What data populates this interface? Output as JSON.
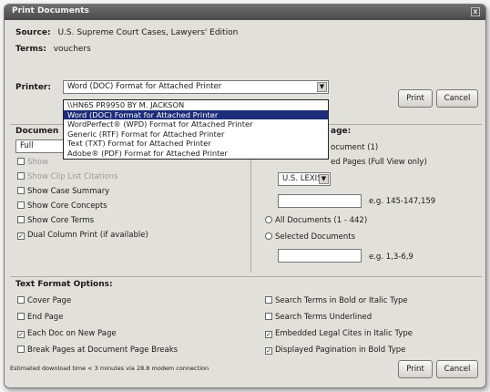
{
  "window": {
    "title": "Print Documents",
    "close_glyph": "x"
  },
  "source": {
    "label": "Source:",
    "value": "U.S. Supreme Court Cases, Lawyers' Edition"
  },
  "terms": {
    "label": "Terms:",
    "value": "vouchers"
  },
  "printer": {
    "label": "Printer:",
    "selected": "Word (DOC) Format for Attached Printer",
    "options": [
      "\\\\HN6S PR9950 BY M. JACKSON",
      "Word (DOC) Format for Attached Printer",
      "WordPerfect® (WPD) Format for Attached Printer",
      "Generic (RTF) Format for Attached Printer",
      "Text (TXT) Format for Attached Printer",
      "Adobe® (PDF) Format for Attached Printer"
    ],
    "highlighted_index": 1
  },
  "buttons": {
    "print": "Print",
    "cancel": "Cancel"
  },
  "document_section": {
    "label": "Documen",
    "format_value": "Full",
    "options": [
      {
        "label": "Show",
        "checked": false,
        "disabled": true
      },
      {
        "label": "Show Clip List Citations",
        "checked": false,
        "disabled": true
      },
      {
        "label": "Show Case Summary",
        "checked": false,
        "disabled": false
      },
      {
        "label": "Show Core Concepts",
        "checked": false,
        "disabled": false
      },
      {
        "label": "Show Core Terms",
        "checked": false,
        "disabled": false
      },
      {
        "label": "Dual Column Print (if available)",
        "checked": true,
        "disabled": false
      }
    ]
  },
  "range_section": {
    "label": "age:",
    "items": [
      "ocument (1)",
      "ed Pages (Full View only)"
    ],
    "page_prefix": "U.S. LEXIS",
    "page_example": "e.g. 145-147,159",
    "all_docs": "All Documents (1 - 442)",
    "selected_docs": "Selected Documents",
    "doc_example": "e.g. 1,3-6,9"
  },
  "text_format": {
    "title": "Text Format Options:",
    "left": [
      {
        "label": "Cover Page",
        "checked": false
      },
      {
        "label": "End Page",
        "checked": false
      },
      {
        "label": "Each Doc on New Page",
        "checked": true
      },
      {
        "label": "Break Pages at Document Page Breaks",
        "checked": false
      }
    ],
    "right": [
      {
        "label": "Search Terms in Bold or Italic Type",
        "checked": false
      },
      {
        "label": "Search Terms Underlined",
        "checked": false
      },
      {
        "label": "Embedded Legal Cites in Italic Type",
        "checked": true
      },
      {
        "label": "Displayed Pagination in Bold Type",
        "checked": true
      }
    ]
  },
  "footer": {
    "estimate": "Estimated download time < 3 minutes via 28.8 modem connection"
  }
}
